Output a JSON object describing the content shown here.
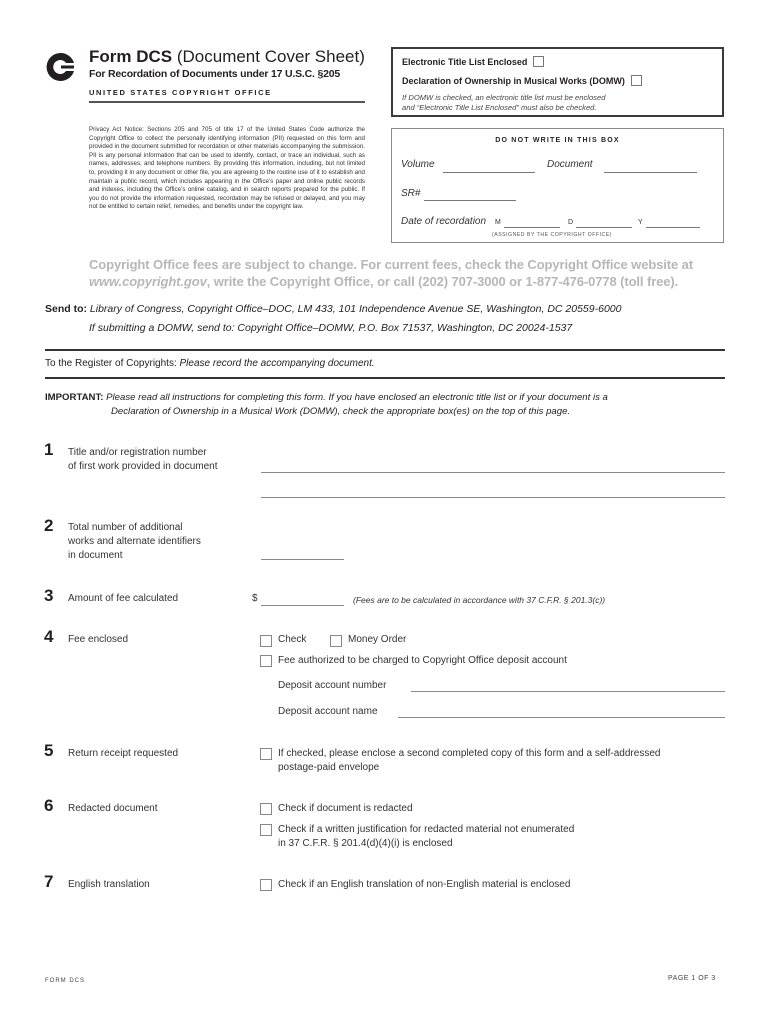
{
  "header": {
    "logo_icon": "copyright-c-logo",
    "title_bold": "Form DCS",
    "title_rest": " (Document Cover Sheet)",
    "subtitle": "For Recordation of Documents under 17 U.S.C. §205",
    "office": "UNITED STATES COPYRIGHT OFFICE"
  },
  "top_box": {
    "electronic_title_list": "Electronic Title List Enclosed",
    "domw": "Declaration of Ownership in Musical Works (DOMW)",
    "note_line1": "If DOMW is checked, an electronic title list must be enclosed",
    "note_line2": "and “Electronic Title List Enclosed” must also be checked."
  },
  "privacy_notice": "Privacy Act Notice: Sections 205 and 705 of title 17 of the United States Code authorize the Copyright Office to collect the personally identifying information (PII) requested on this form and provided in the document submitted for recordation or other materials accompanying the submission. PII is any personal information that can be used to identify, contact, or trace an individual, such as names, addresses, and telephone numbers. By providing this information, including, but not limited to, providing it in any document or other file, you are agreeing to the routine use of it to establish and maintain a public record, which includes appearing in the Office’s paper and online public records and indexes, including the Office’s online catalog, and in search reports prepared for the public. If you do not provide the information requested, recordation may be refused or delayed, and you may not be entitled to certain relief, remedies, and benefits under the copyright law.",
  "office_box": {
    "header": "DO NOT WRITE IN THIS BOX",
    "volume": "Volume",
    "document": "Document",
    "sr": "SR#",
    "date": "Date of recordation",
    "m": "M",
    "d": "D",
    "y": "Y",
    "assigned": "(ASSIGNED BY THE COPYRIGHT OFFICE)"
  },
  "fees_notice": {
    "line1": "Copyright Office fees are subject to change. For current fees, check the Copyright Office website at",
    "url": "www.copyright.gov",
    "line2_rest": ", write the Copyright Office, or call (202) 707-3000 or 1-877-476-0778 (toll free)."
  },
  "send_to": {
    "label": "Send to:",
    "address": "Library of Congress, Copyright Office–DOC, LM 433, 101 Independence Avenue SE, Washington, DC 20559-6000",
    "domw_address": "If submitting a DOMW, send to: Copyright Office–DOMW, P.O. Box 71537, Washington, DC 20024-1537"
  },
  "register": {
    "lead": "To the Register of Copyrights: ",
    "request": "Please record the accompanying document."
  },
  "important": {
    "label": "IMPORTANT:",
    "line1": " Please read all instructions for completing this form. If you have enclosed an electronic title list or if your document is a",
    "line2": "Declaration of Ownership in a Musical Work (DOMW), check the appropriate box(es) on the top of this page."
  },
  "items": {
    "q1": {
      "num": "1",
      "line1": "Title and/or registration number",
      "line2": "of first work provided in document"
    },
    "q2": {
      "num": "2",
      "line1": "Total number of additional",
      "line2": "works and alternate identifiers",
      "line3": "in document"
    },
    "q3": {
      "num": "3",
      "label": "Amount of fee calculated",
      "currency": "$",
      "note": "(Fees are to be calculated in accordance with 37 C.F.R. § 201.3(c))"
    },
    "q4": {
      "num": "4",
      "label": "Fee enclosed",
      "check": "Check",
      "money_order": "Money Order",
      "deposit_auth": "Fee authorized to be charged to Copyright Office deposit account",
      "acct_number": "Deposit account number",
      "acct_name": "Deposit account name"
    },
    "q5": {
      "num": "5",
      "label": "Return receipt requested",
      "text1": "If checked, please enclose a second completed copy of this form and a self-addressed",
      "text2": "postage-paid envelope"
    },
    "q6": {
      "num": "6",
      "label": "Redacted document",
      "opt1": "Check if document is redacted",
      "opt2_line1": "Check if a written justification for redacted material not enumerated",
      "opt2_line2": "in 37 C.F.R. § 201.4(d)(4)(i) is enclosed"
    },
    "q7": {
      "num": "7",
      "label": "English translation",
      "opt": "Check if an English translation of non-English material is enclosed"
    }
  },
  "footer": {
    "form": "FORM DCS",
    "page": "PAGE 1 OF 3"
  }
}
